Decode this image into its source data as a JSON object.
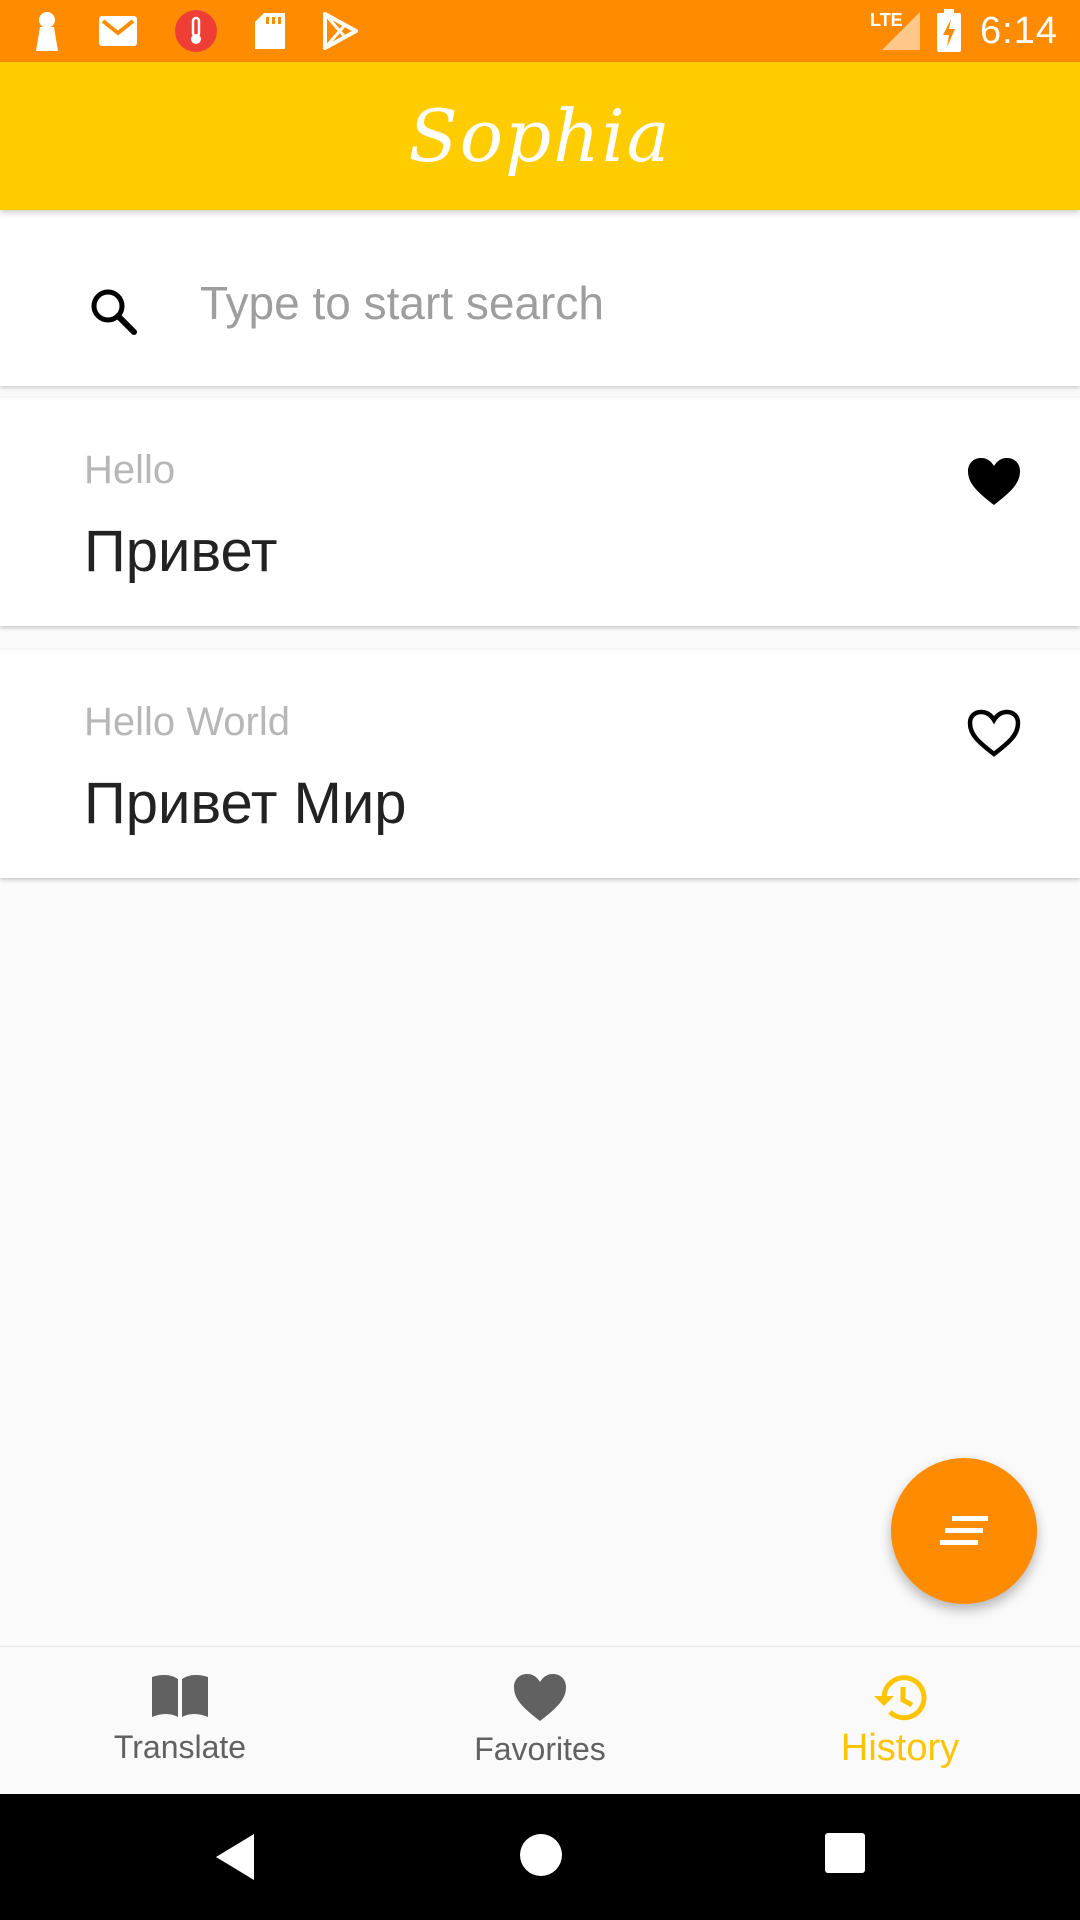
{
  "status_bar": {
    "time": "6:14",
    "network": "LTE",
    "icons": [
      "keyhole-icon",
      "gmail-icon",
      "thermometer-icon",
      "sd-card-icon",
      "play-store-icon",
      "signal-icon",
      "battery-charging-icon"
    ],
    "color": "#ff8c00"
  },
  "app_bar": {
    "title": "Sophia",
    "color": "#ffcc00"
  },
  "search": {
    "placeholder": "Type to start search",
    "value": ""
  },
  "history": {
    "items": [
      {
        "source": "Hello",
        "target": "Привет",
        "favorite": true
      },
      {
        "source": "Hello World",
        "target": "Привет Мир",
        "favorite": false
      }
    ]
  },
  "fab": {
    "icon": "sort-icon",
    "color": "#ff8c00"
  },
  "bottom_nav": {
    "items": [
      {
        "label": "Translate",
        "icon": "book-icon"
      },
      {
        "label": "Favorites",
        "icon": "heart-icon"
      },
      {
        "label": "History",
        "icon": "history-icon"
      }
    ],
    "active": "History",
    "active_color": "#ffc400"
  }
}
